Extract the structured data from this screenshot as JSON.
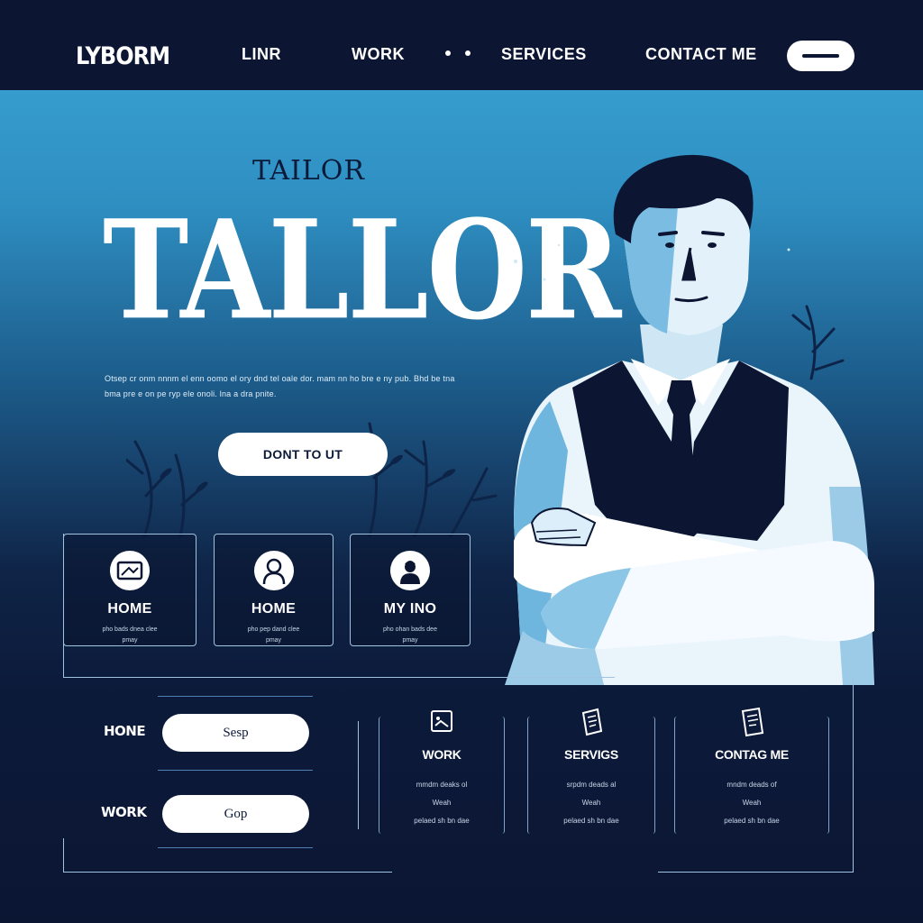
{
  "nav": {
    "logo": "LYBORM",
    "links": [
      "LINR",
      "WORK",
      "SERVICES",
      "CONTACT ME"
    ]
  },
  "hero": {
    "subtitle": "TAILOR",
    "title": "TALLOR",
    "body": "Otsep cr onm nnnm el enn oomo el ory dnd tel oale dor. mam nn ho bre e ny pub. Bhd be tna bma pre e on pe ryp ele onoli. lna a dra pnite.",
    "cta_label": "DONT TO UT"
  },
  "cards": [
    {
      "icon": "screen-icon",
      "title": "HOME",
      "desc": "pho bads dnea clee",
      "desc2": "pmay"
    },
    {
      "icon": "person-icon",
      "title": "HOME",
      "desc": "pho pep dand clee",
      "desc2": "pmay"
    },
    {
      "icon": "avatar-icon",
      "title": "MY INO",
      "desc": "pho ohan bads dee",
      "desc2": "pmay"
    }
  ],
  "form": {
    "rows": [
      {
        "label": "HONE",
        "value": "Sesp"
      },
      {
        "label": "WORK",
        "value": "Gop"
      }
    ]
  },
  "bottom_cards": [
    {
      "icon": "photo-icon",
      "title": "WORK",
      "line1": "mmdm deaks ol",
      "line2": "Weah",
      "line3": "pelaed sh bn dae"
    },
    {
      "icon": "document-icon",
      "title": "SERVIGS",
      "line1": "srpdm deads al",
      "line2": "Weah",
      "line3": "pelaed sh bn dae"
    },
    {
      "icon": "clipboard-icon",
      "title": "CONTAG ME",
      "line1": "mndm deads of",
      "line2": "Weah",
      "line3": "pelaed sh bn dae"
    }
  ],
  "colors": {
    "navy": "#0c1633",
    "sky": "#3ba6d6",
    "white": "#ffffff"
  }
}
